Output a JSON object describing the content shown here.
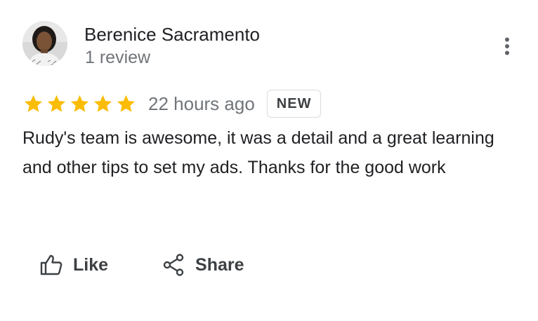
{
  "reviewer": {
    "name": "Berenice Sacramento",
    "meta": "1 review",
    "avatar_icon": "user-photo"
  },
  "more_icon": "more-vertical-icon",
  "rating": {
    "stars": 5,
    "max_stars": 5,
    "star_color": "#fbbc04",
    "time": "22 hours ago",
    "badge": "NEW"
  },
  "review": {
    "text": "Rudy's team is awesome, it was a detail and a great learning and other tips to set my ads. Thanks for the good work"
  },
  "actions": {
    "like_label": "Like",
    "like_icon": "thumbs-up-icon",
    "share_label": "Share",
    "share_icon": "share-icon"
  }
}
